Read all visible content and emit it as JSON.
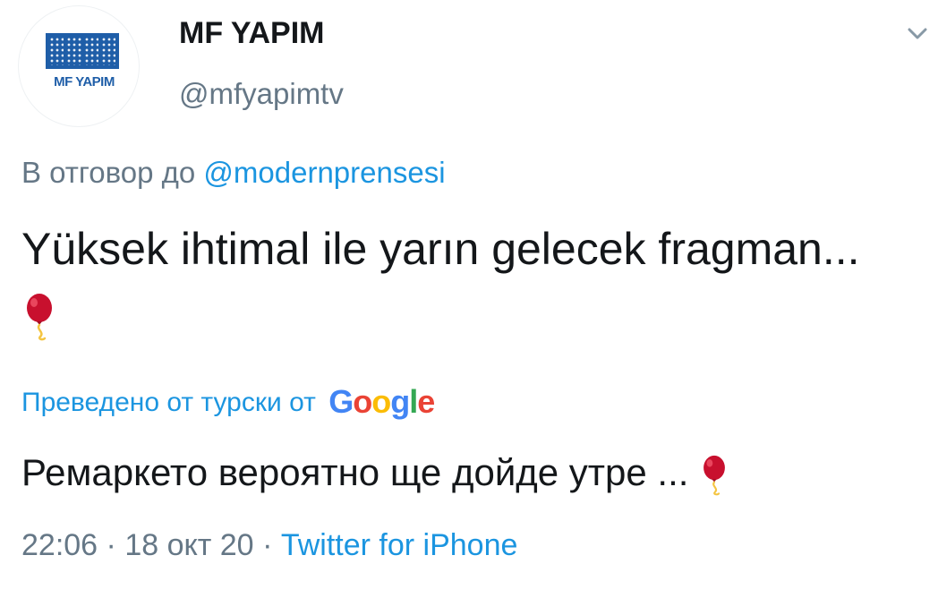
{
  "author": {
    "display_name": "MF YAPIM",
    "handle": "@mfyapimtv",
    "avatar_logo_text": "MF YAPIM"
  },
  "reply": {
    "prefix": "В отговор до ",
    "mention": "@modernprensesi"
  },
  "tweet": {
    "text": "Yüksek ihtimal ile yarın gelecek fragman...",
    "emoji": "balloon-icon"
  },
  "translation": {
    "label": "Преведено от турски от",
    "provider": "Google",
    "text": "Ремаркето вероятно ще дойде утре ..."
  },
  "meta": {
    "time": "22:06",
    "date": "18 окт 20",
    "separator": "·",
    "source": "Twitter for iPhone"
  },
  "colors": {
    "link": "#1b95e0",
    "secondary_text": "#657786",
    "primary_text": "#14171a",
    "brand_blue": "#1f5ea8"
  }
}
